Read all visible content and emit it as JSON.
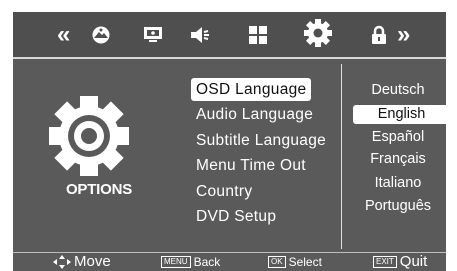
{
  "topbar": {
    "icons": [
      {
        "name": "double-chevron-left-icon",
        "glyph": "«"
      },
      {
        "name": "picture-mode-icon"
      },
      {
        "name": "screen-icon"
      },
      {
        "name": "speaker-icon"
      },
      {
        "name": "grid-icon"
      },
      {
        "name": "gear-icon"
      },
      {
        "name": "lock-icon"
      },
      {
        "name": "double-chevron-right-icon",
        "glyph": "»"
      }
    ],
    "left_glyph": "«",
    "right_glyph": "»"
  },
  "options": {
    "label": "OPTIONS"
  },
  "menu": {
    "items": [
      "OSD Language",
      "Audio Language",
      "Subtitle Language",
      "Menu Time Out",
      "Country",
      "DVD Setup"
    ],
    "selected_index": 0
  },
  "languages": {
    "items": [
      "Deutsch",
      "English",
      "Español",
      "Français",
      "Italiano",
      "Português"
    ],
    "selected_index": 1
  },
  "footer": {
    "move": "Move",
    "menu_key": "MENU",
    "back": "Back",
    "ok_key": "OK",
    "select": "Select",
    "exit_key": "EXIT",
    "quit": "Quit"
  },
  "colors": {
    "background": "#5a5a5a",
    "highlight": "#ffffff",
    "text": "#ffffff"
  }
}
